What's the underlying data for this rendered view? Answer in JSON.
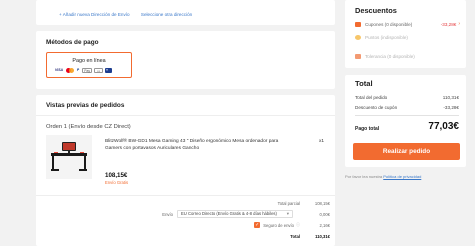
{
  "address": {
    "add_new": "+ Añadir nueva Dirección de Envío",
    "select_other": "Seleccione otra dirección"
  },
  "payment": {
    "title": "Métodos de pago",
    "option_label": "Pago en línea",
    "logos": [
      "VISA",
      "Mastercard",
      "PayPal",
      "Pay",
      "box",
      "card"
    ]
  },
  "orders": {
    "title": "Vistas previas de pedidos",
    "order_head": "Orden 1 (Envío desde CZ Direct)",
    "product": {
      "title": "BlitzWolf® BW-GD1 Mesa Gaming 43 \" Diseño ergonómico Mesa ordenador para Gamers con portavasos Auriculares Gancho",
      "qty": "x1",
      "price": "108,15€",
      "shipping_note": "Envío Gratis"
    },
    "summary": {
      "subtotal_label": "Total parcial",
      "subtotal_val": "108,15€",
      "shipping_label": "Envío",
      "shipping_option": "EU Correo Directo (Envío Gratis & 4-8 días hábiles)",
      "shipping_val": "0,00€",
      "insurance_label": "Seguro de envío",
      "insurance_val": "2,16€",
      "total_label": "Total",
      "total_val": "110,31€"
    }
  },
  "discounts": {
    "title": "Descuentos",
    "coupons_label": "Cupones (0 disponible)",
    "coupons_val": "-33,28€",
    "points_label": "Puntos (indisponible)",
    "tolerance_label": "Tolerancia (0 disponible)"
  },
  "totals": {
    "title": "Total",
    "order_total_label": "Total del pedido",
    "order_total_val": "110,31€",
    "coupon_label": "Descuento de cupón",
    "coupon_val": "-33,28€",
    "pay_total_label": "Pago total",
    "pay_total_val": "77,03€",
    "button": "Realizar pedido"
  },
  "policy": {
    "prefix": "Por favor lea nuestra",
    "link": "Política de privacidad"
  },
  "colors": {
    "accent": "#f26b30",
    "link": "#3a78c9",
    "negative": "#e4393c"
  }
}
